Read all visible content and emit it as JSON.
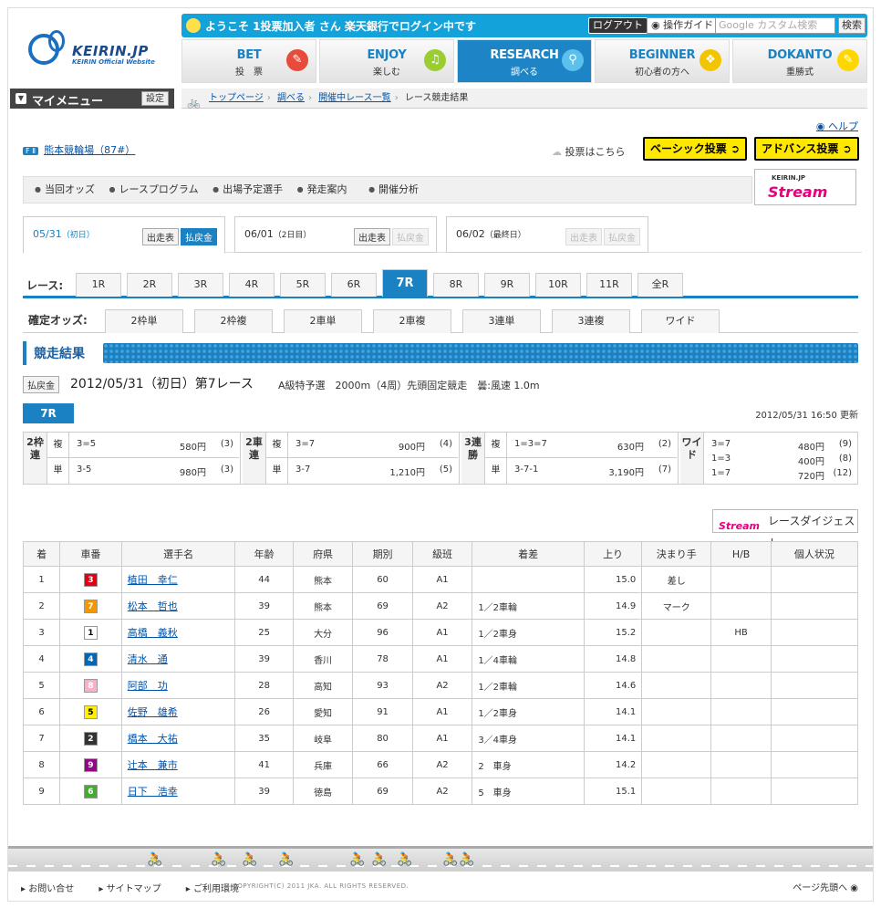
{
  "header": {
    "logo_main": "KEIRIN.JP",
    "logo_sub": "KEIRIN Official Website",
    "welcome": "ようこそ 1投票加入者 さん 楽天銀行でログイン中です",
    "logout": "ログアウト",
    "guide": "操作ガイド",
    "search_placeholder": "Google カスタム検索",
    "search_btn": "検索"
  },
  "nav": [
    {
      "en": "BET",
      "jp": "投　票",
      "icon": "pencil-icon",
      "color": "#e64b3c"
    },
    {
      "en": "ENJOY",
      "jp": "楽しむ",
      "icon": "music-icon",
      "color": "#9acd32"
    },
    {
      "en": "RESEARCH",
      "jp": "調べる",
      "icon": "magnifier-icon",
      "color": "#5bc0eb"
    },
    {
      "en": "BEGINNER",
      "jp": "初心者の方へ",
      "icon": "beginner-mark-icon",
      "color": "#f3c400"
    },
    {
      "en": "DOKANTO",
      "jp": "重勝式",
      "icon": "pencil-icon",
      "color": "#ffd700"
    }
  ],
  "mymenu": {
    "label": "マイメニュー",
    "setting": "設定"
  },
  "breadcrumb": [
    "トップページ",
    "調べる",
    "開催中レース一覧",
    "レース競走結果"
  ],
  "help": "ヘルプ",
  "venue": {
    "badge": "F Ⅱ",
    "name": "熊本競輪場（87#）"
  },
  "vote_here": "投票はこちら",
  "basic_vote": "ベーシック投票",
  "advance_vote": "アドバンス投票",
  "subnav": [
    "当回オッズ",
    "レースプログラム",
    "出場予定選手",
    "発走案内",
    "開催分析"
  ],
  "stream": {
    "top": "KEIRIN.JP",
    "main": "Stream"
  },
  "days": [
    {
      "date": "05/31",
      "tag": "（初日）",
      "btn1": "出走表",
      "btn2": "払戻金"
    },
    {
      "date": "06/01",
      "tag": "（2日目）",
      "btn1": "出走表",
      "btn2": "払戻金"
    },
    {
      "date": "06/02",
      "tag": "（最終日）",
      "btn1": "出走表",
      "btn2": "払戻金"
    }
  ],
  "race_label": "レース:",
  "races": [
    "1R",
    "2R",
    "3R",
    "4R",
    "5R",
    "6R",
    "7R",
    "8R",
    "9R",
    "10R",
    "11R",
    "全R"
  ],
  "odds_label": "確定オッズ:",
  "odds_tabs": [
    "2枠単",
    "2枠複",
    "2車単",
    "2車複",
    "3連単",
    "3連複",
    "ワイド"
  ],
  "result_title": "競走結果",
  "race_info": {
    "pay": "払戻金",
    "main": "2012/05/31（初日）第7レース",
    "sub": "A級特予選　2000m（4周）先頭固定競走　曇:風速 1.0m",
    "badge": "7R",
    "updated": "2012/05/31 16:50 更新"
  },
  "payouts": {
    "g1": {
      "key": "2枠連",
      "r1": {
        "k": "複",
        "c": "3=5",
        "y": "580円",
        "p": "(3)"
      },
      "r2": {
        "k": "単",
        "c": "3-5",
        "y": "980円",
        "p": "(3)"
      }
    },
    "g2": {
      "key": "2車連",
      "r1": {
        "k": "複",
        "c": "3=7",
        "y": "900円",
        "p": "(4)"
      },
      "r2": {
        "k": "単",
        "c": "3-7",
        "y": "1,210円",
        "p": "(5)"
      }
    },
    "g3": {
      "key": "3連勝",
      "r1": {
        "k": "複",
        "c": "1=3=7",
        "y": "630円",
        "p": "(2)"
      },
      "r2": {
        "k": "単",
        "c": "3-7-1",
        "y": "3,190円",
        "p": "(7)"
      }
    },
    "g4": {
      "key": "ワイド",
      "rows": [
        {
          "c": "3=7",
          "y": "480円",
          "p": "(9)"
        },
        {
          "c": "1=3",
          "y": "400円",
          "p": "(8)"
        },
        {
          "c": "1=7",
          "y": "720円",
          "p": "(12)"
        }
      ]
    }
  },
  "digest": {
    "stream": "Stream",
    "label": "レースダイジェスト"
  },
  "columns": [
    "着",
    "車番",
    "選手名",
    "年齢",
    "府県",
    "期別",
    "級班",
    "着差",
    "上り",
    "決まり手",
    "H/B",
    "個人状況"
  ],
  "results": [
    {
      "rank": "1",
      "car": "3",
      "carColor": "#e60012",
      "carText": "#fff",
      "name": "植田　幸仁",
      "age": "44",
      "pref": "熊本",
      "term": "60",
      "cls": "A1",
      "margin": "",
      "up": "15.0",
      "kimari": "差し",
      "hb": ""
    },
    {
      "rank": "2",
      "car": "7",
      "carColor": "#f39800",
      "carText": "#fff",
      "name": "松本　哲也",
      "age": "39",
      "pref": "熊本",
      "term": "69",
      "cls": "A2",
      "margin": "1／2車輪",
      "up": "14.9",
      "kimari": "マーク",
      "hb": ""
    },
    {
      "rank": "3",
      "car": "1",
      "carColor": "#ffffff",
      "carText": "#000",
      "name": "高橋　義秋",
      "age": "25",
      "pref": "大分",
      "term": "96",
      "cls": "A1",
      "margin": "1／2車身",
      "up": "15.2",
      "kimari": "",
      "hb": "HB"
    },
    {
      "rank": "4",
      "car": "4",
      "carColor": "#0068b7",
      "carText": "#fff",
      "name": "清水　通",
      "age": "39",
      "pref": "香川",
      "term": "78",
      "cls": "A1",
      "margin": "1／4車輪",
      "up": "14.8",
      "kimari": "",
      "hb": ""
    },
    {
      "rank": "5",
      "car": "8",
      "carColor": "#f9b1c7",
      "carText": "#fff",
      "name": "阿部　功",
      "age": "28",
      "pref": "高知",
      "term": "93",
      "cls": "A2",
      "margin": "1／2車輪",
      "up": "14.6",
      "kimari": "",
      "hb": ""
    },
    {
      "rank": "6",
      "car": "5",
      "carColor": "#fff000",
      "carText": "#000",
      "name": "佐野　雄希",
      "age": "26",
      "pref": "愛知",
      "term": "91",
      "cls": "A1",
      "margin": "1／2車身",
      "up": "14.1",
      "kimari": "",
      "hb": ""
    },
    {
      "rank": "7",
      "car": "2",
      "carColor": "#333333",
      "carText": "#fff",
      "name": "橋本　大祐",
      "age": "35",
      "pref": "岐阜",
      "term": "80",
      "cls": "A1",
      "margin": "3／4車身",
      "up": "14.1",
      "kimari": "",
      "hb": ""
    },
    {
      "rank": "8",
      "car": "9",
      "carColor": "#920783",
      "carText": "#fff",
      "name": "辻本　兼市",
      "age": "41",
      "pref": "兵庫",
      "term": "66",
      "cls": "A2",
      "margin": "2　車身",
      "up": "14.2",
      "kimari": "",
      "hb": ""
    },
    {
      "rank": "9",
      "car": "6",
      "carColor": "#3fae2a",
      "carText": "#fff",
      "name": "日下　浩幸",
      "age": "39",
      "pref": "徳島",
      "term": "69",
      "cls": "A2",
      "margin": "5　車身",
      "up": "15.1",
      "kimari": "",
      "hb": ""
    }
  ],
  "footer": {
    "links": [
      "お問い合せ",
      "サイトマップ",
      "ご利用環境"
    ],
    "copyright": "COPYRIGHT(C) 2011 JKA. ALL RIGHTS RESERVED.",
    "page_top": "ページ先頭へ"
  }
}
